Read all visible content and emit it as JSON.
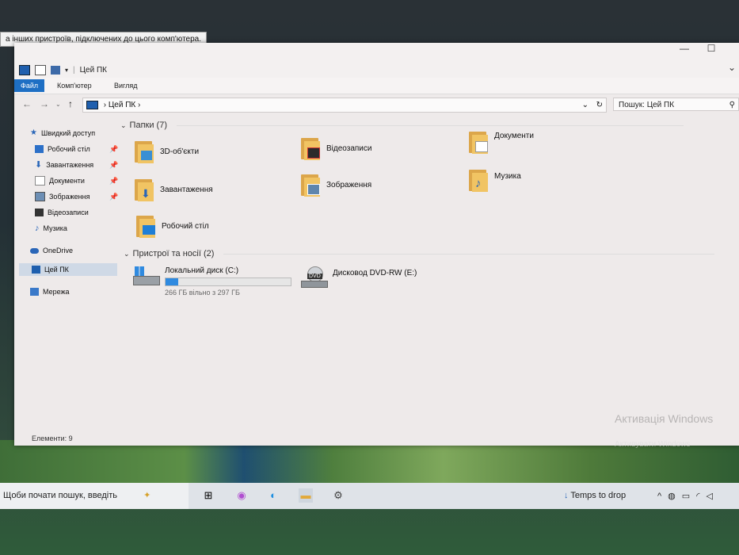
{
  "tooltip": "а інших пристроїв, підключених до цього комп'ютера.",
  "window": {
    "title": "Цей ПК",
    "controls": {
      "minimize": "—",
      "maximize": "☐",
      "expand": "⌄"
    }
  },
  "ribbon": {
    "tabs": [
      {
        "label": "Файл",
        "active": true
      },
      {
        "label": "Комп'ютер",
        "active": false
      },
      {
        "label": "Вигляд",
        "active": false
      }
    ]
  },
  "address": {
    "path": "Цей ПК",
    "search_placeholder": "Пошук: Цей ПК"
  },
  "nav": {
    "items": [
      {
        "label": "Швидкий доступ",
        "icon": "star-icon",
        "pinned": false
      },
      {
        "label": "Робочий стіл",
        "icon": "desktop-icon",
        "pinned": true
      },
      {
        "label": "Завантаження",
        "icon": "download-icon",
        "pinned": true
      },
      {
        "label": "Документи",
        "icon": "documents-icon",
        "pinned": true
      },
      {
        "label": "Зображення",
        "icon": "pictures-icon",
        "pinned": true
      },
      {
        "label": "Відеозаписи",
        "icon": "video-icon",
        "pinned": false
      },
      {
        "label": "Музика",
        "icon": "music-icon",
        "pinned": false
      },
      {
        "label": "OneDrive",
        "icon": "cloud-icon",
        "pinned": false
      },
      {
        "label": "Цей ПК",
        "icon": "pc-icon",
        "pinned": false,
        "selected": true
      },
      {
        "label": "Мережа",
        "icon": "network-icon",
        "pinned": false
      }
    ]
  },
  "folders": {
    "header": "Папки (7)",
    "items": [
      {
        "label": "3D-об'єкти",
        "icon": "3d-objects-icon"
      },
      {
        "label": "Відеозаписи",
        "icon": "video-icon"
      },
      {
        "label": "Документи",
        "icon": "documents-icon"
      },
      {
        "label": "Завантаження",
        "icon": "download-icon"
      },
      {
        "label": "Зображення",
        "icon": "pictures-icon"
      },
      {
        "label": "Музика",
        "icon": "music-icon"
      },
      {
        "label": "Робочий стіл",
        "icon": "desktop-icon"
      }
    ]
  },
  "devices": {
    "header": "Пристрої та носії (2)",
    "items": [
      {
        "label": "Локальний диск (C:)",
        "sub": "266 ГБ вільно з 297 ГБ",
        "used_fraction": 0.104,
        "icon": "hard-drive-icon"
      },
      {
        "label": "Дисковод DVD-RW (E:)",
        "sub": "",
        "icon": "dvd-drive-icon",
        "badge": "DVD"
      }
    ]
  },
  "status": "Елементи: 9",
  "watermark": {
    "title": "Активація Windows",
    "sub": "Активувати Windows"
  },
  "taskbar": {
    "search": "Щоби почати пошук, введіть",
    "weather": "Temps to drop"
  },
  "colors": {
    "accent": "#1e6fc4",
    "folder": "#f1c463",
    "selection": "#cfd9e6"
  }
}
